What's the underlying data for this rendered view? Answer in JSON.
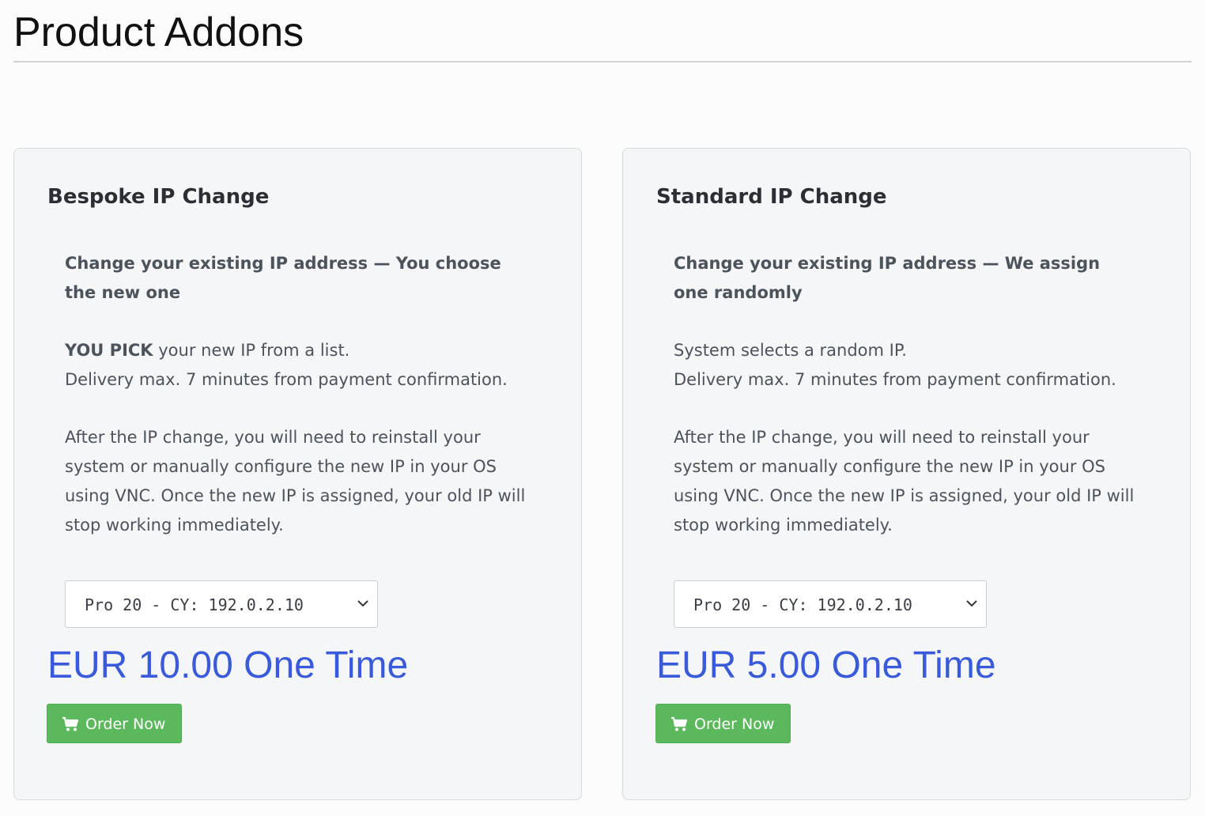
{
  "page": {
    "title": "Product Addons"
  },
  "colors": {
    "price": "#3a5bd9",
    "order_button": "#5cb85c",
    "card_background": "#f5f6f8"
  },
  "addons": [
    {
      "title": "Bespoke IP Change",
      "headline": "Change your existing IP address — You choose the new one",
      "intro_strong": "YOU PICK",
      "intro_rest": " your new IP from a list.",
      "delivery": "Delivery max. 7 minutes from payment confirmation.",
      "warning": "After the IP change, you will need to reinstall your system or manually configure the new IP in your OS using VNC. Once the new IP is assigned, your old IP will stop working immediately.",
      "selected_service": "Pro 20 - CY: 192.0.2.10",
      "price": "EUR 10.00 One Time",
      "order_label": "Order Now",
      "order_icon": "cart-icon"
    },
    {
      "title": "Standard IP Change",
      "headline": "Change your existing IP address — We assign one randomly",
      "intro_strong": "",
      "intro_rest": "System selects a random IP.",
      "delivery": "Delivery max. 7 minutes from payment confirmation.",
      "warning": "After the IP change, you will need to reinstall your system or manually configure the new IP in your OS using VNC. Once the new IP is assigned, your old IP will stop working immediately.",
      "selected_service": "Pro 20 - CY: 192.0.2.10",
      "price": "EUR 5.00 One Time",
      "order_label": "Order Now",
      "order_icon": "cart-icon"
    }
  ]
}
